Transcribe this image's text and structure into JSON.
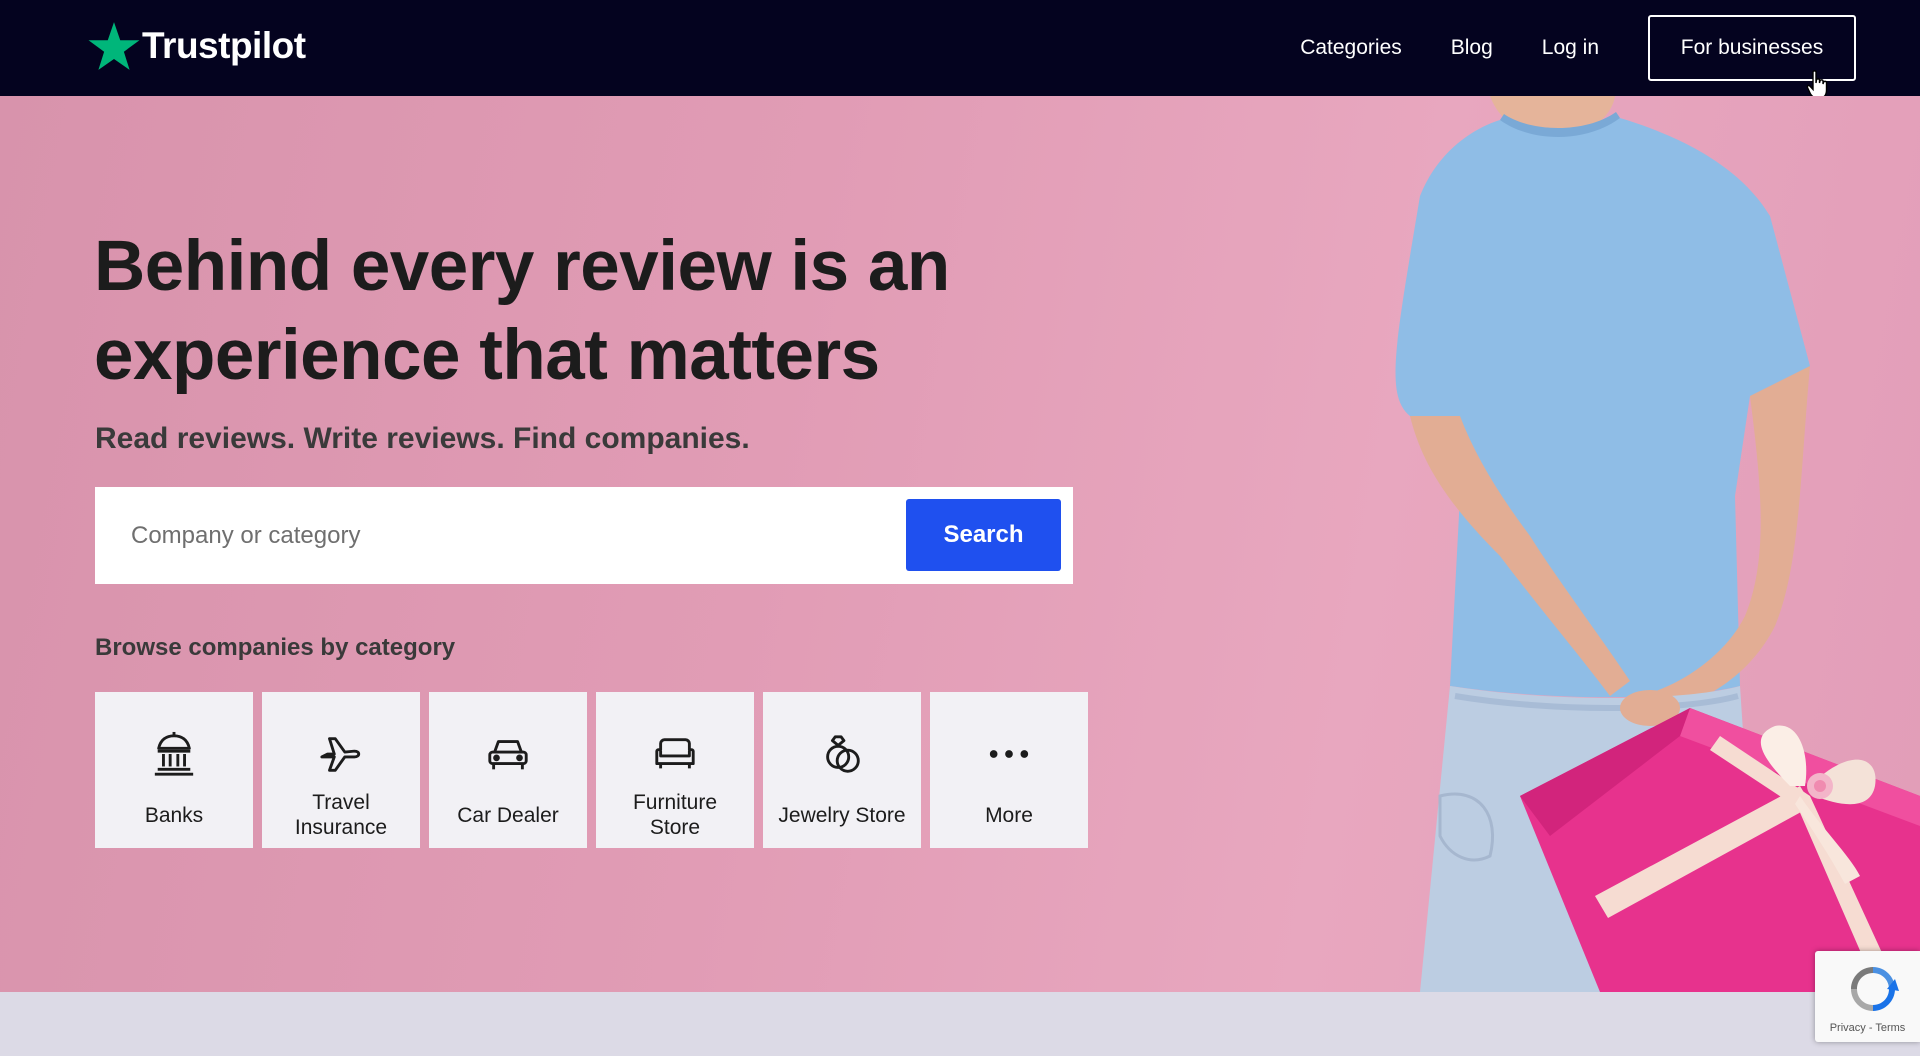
{
  "brand": {
    "name": "Trustpilot",
    "star_color": "#00b67a"
  },
  "nav": {
    "links": [
      "Categories",
      "Blog",
      "Log in"
    ],
    "business_button": "For businesses"
  },
  "hero": {
    "headline": "Behind every review is an experience that matters",
    "subhead": "Read reviews. Write reviews. Find companies.",
    "search": {
      "placeholder": "Company or category",
      "value": "",
      "button": "Search"
    },
    "browse_title": "Browse companies by category",
    "categories": [
      {
        "label": "Banks",
        "icon": "bank-icon"
      },
      {
        "label": "Travel Insurance",
        "icon": "airplane-icon"
      },
      {
        "label": "Car Dealer",
        "icon": "car-icon"
      },
      {
        "label": "Furniture Store",
        "icon": "sofa-icon"
      },
      {
        "label": "Jewelry Store",
        "icon": "ring-icon"
      },
      {
        "label": "More",
        "icon": "more-dots-icon"
      }
    ]
  },
  "recaptcha": {
    "privacy": "Privacy",
    "separator": "-",
    "terms": "Terms"
  },
  "colors": {
    "nav_bg": "#04031f",
    "hero_bg": "#e19cb5",
    "search_button": "#1f50ef",
    "tile_bg": "#f2f1f5"
  }
}
